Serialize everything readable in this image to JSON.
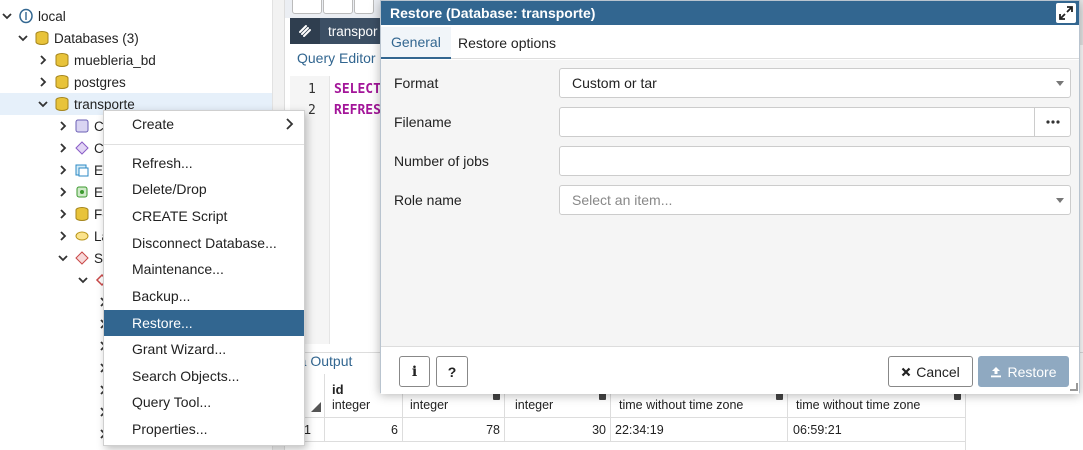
{
  "tree": {
    "items": [
      {
        "label": "local",
        "icon": "server-elephant-icon",
        "expand": "collapse"
      },
      {
        "label": "Databases (3)",
        "icon": "databases-icon",
        "expand": "collapse"
      },
      {
        "label": "muebleria_bd",
        "icon": "database-icon",
        "expand": "expand"
      },
      {
        "label": "postgres",
        "icon": "database-icon",
        "expand": "expand"
      },
      {
        "label": "transporte",
        "icon": "database-icon",
        "expand": "collapse"
      },
      {
        "label": "Ca",
        "icon": "cast-icon",
        "expand": "expand"
      },
      {
        "label": "Ca",
        "icon": "catalog-icon",
        "expand": "expand"
      },
      {
        "label": "Ev",
        "icon": "event-trigger-icon",
        "expand": "expand"
      },
      {
        "label": "Ex",
        "icon": "extension-icon",
        "expand": "expand"
      },
      {
        "label": "Fo",
        "icon": "foreign-data-wrapper-icon",
        "expand": "expand"
      },
      {
        "label": "La",
        "icon": "language-icon",
        "expand": "expand"
      },
      {
        "label": "Sc",
        "icon": "schemas-icon",
        "expand": "collapse"
      }
    ]
  },
  "query_tool": {
    "tab_label": "transpor",
    "editor_title": "Query Editor",
    "lines": [
      {
        "num": "1",
        "code": "SELECT"
      },
      {
        "num": "2",
        "code": "REFRES"
      }
    ],
    "data_output_title": "ata Output",
    "columns": [
      {
        "name": "id",
        "type": "integer"
      },
      {
        "name": "",
        "type": "integer"
      },
      {
        "name": "",
        "type": "integer"
      },
      {
        "name": "",
        "type": "time without time zone"
      },
      {
        "name": "",
        "type": "time without time zone"
      }
    ],
    "rows": [
      {
        "row_num": "1",
        "cells": [
          "6",
          "78",
          "30",
          "22:34:19",
          "06:59:21"
        ]
      }
    ]
  },
  "context_menu": {
    "items": [
      {
        "label": "Create",
        "submenu": true
      },
      {
        "label": "Refresh..."
      },
      {
        "label": "Delete/Drop"
      },
      {
        "label": "CREATE Script"
      },
      {
        "label": "Disconnect Database..."
      },
      {
        "label": "Maintenance..."
      },
      {
        "label": "Backup..."
      },
      {
        "label": "Restore...",
        "active": true
      },
      {
        "label": "Grant Wizard..."
      },
      {
        "label": "Search Objects..."
      },
      {
        "label": "Query Tool..."
      },
      {
        "label": "Properties..."
      }
    ]
  },
  "dialog": {
    "title": "Restore (Database: transporte)",
    "tabs": [
      {
        "label": "General",
        "active": true
      },
      {
        "label": "Restore options"
      }
    ],
    "fields": {
      "format": {
        "label": "Format",
        "value": "Custom or tar"
      },
      "filename": {
        "label": "Filename",
        "value": ""
      },
      "jobs": {
        "label": "Number of jobs",
        "value": ""
      },
      "role": {
        "label": "Role name",
        "placeholder": "Select an item..."
      }
    },
    "buttons": {
      "info": "i",
      "help": "?",
      "cancel": "Cancel",
      "restore": "Restore"
    }
  },
  "colors": {
    "accent": "#326690",
    "title_bar": "#326690",
    "keyword": "#a31599",
    "restore_disabled": "#8fa9c1"
  }
}
